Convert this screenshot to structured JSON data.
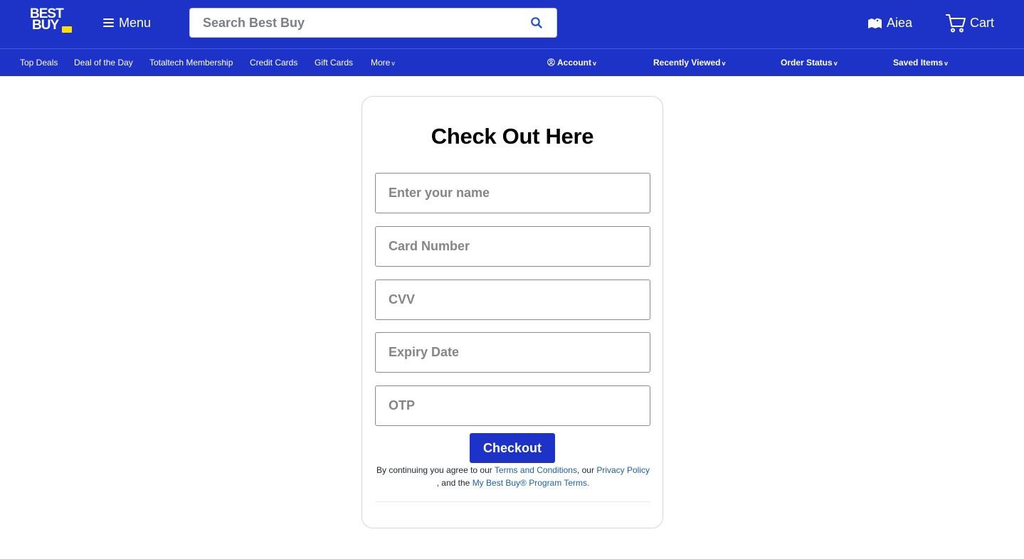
{
  "header": {
    "logo": {
      "line1": "BEST",
      "line2": "BUY"
    },
    "menu_label": "Menu",
    "search_placeholder": "Search Best Buy",
    "store_label": "Aiea",
    "cart_label": "Cart"
  },
  "subnav": {
    "left": [
      "Top Deals",
      "Deal of the Day",
      "Totaltech Membership",
      "Credit Cards",
      "Gift Cards",
      "More"
    ],
    "right": [
      "Account",
      "Recently Viewed",
      "Order Status",
      "Saved Items"
    ]
  },
  "checkout_form": {
    "title": "Check Out Here",
    "fields": [
      {
        "placeholder": "Enter your name"
      },
      {
        "placeholder": "Card Number"
      },
      {
        "placeholder": "CVV"
      },
      {
        "placeholder": "Expiry Date"
      },
      {
        "placeholder": "OTP"
      }
    ],
    "submit_label": "Checkout",
    "legal": {
      "prefix": "By continuing you agree to our ",
      "terms_link": "Terms and Conditions",
      "mid1": ", our ",
      "privacy_link": "Privacy Policy",
      "mid2": " , and the ",
      "program_link": "My Best Buy® Program Terms."
    }
  },
  "colors": {
    "brand_blue": "#1d33c7",
    "brand_yellow": "#ffe000",
    "link_blue": "#1a5fb4"
  },
  "icons": [
    "hamburger-icon",
    "search-icon",
    "store-map-icon",
    "cart-icon",
    "account-icon",
    "caret-down-icon"
  ]
}
